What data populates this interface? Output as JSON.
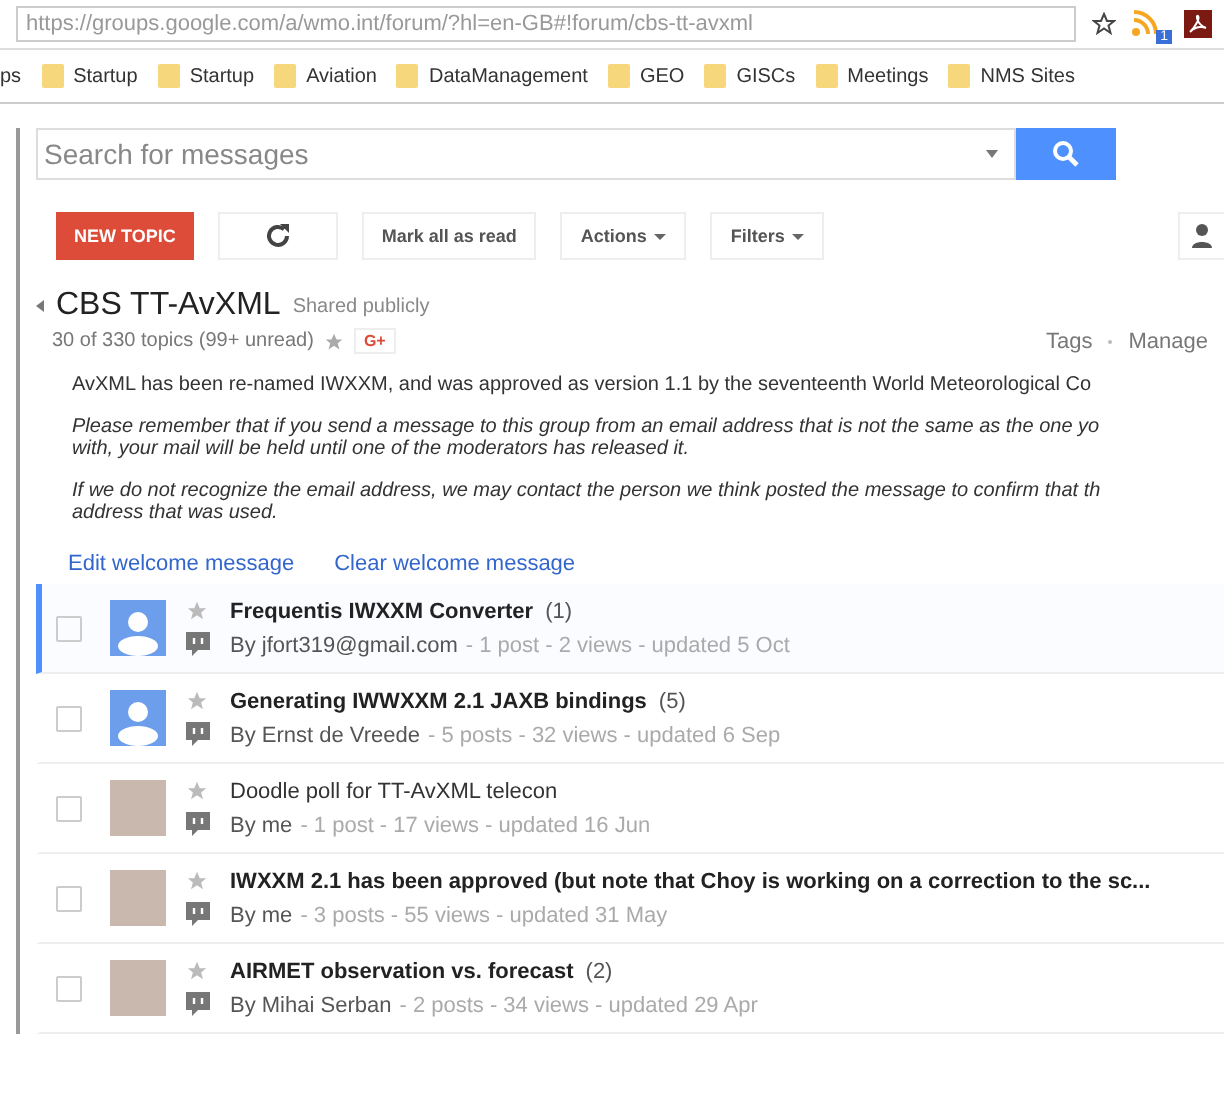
{
  "address_bar": {
    "url": "https://groups.google.com/a/wmo.int/forum/?hl=en-GB#!forum/cbs-tt-avxml",
    "extension_badge": "1"
  },
  "bookmarks": [
    "ps",
    "Startup",
    "Startup",
    "Aviation",
    "DataManagement",
    "GEO",
    "GISCs",
    "Meetings",
    "NMS Sites"
  ],
  "search": {
    "placeholder": "Search for messages"
  },
  "toolbar": {
    "new_topic": "NEW TOPIC",
    "mark_all_read": "Mark all as read",
    "actions": "Actions",
    "filters": "Filters"
  },
  "group": {
    "name": "CBS TT-AvXML",
    "visibility": "Shared publicly",
    "count": "30 of 330 topics (99+ unread)",
    "gplus": "G+",
    "links": [
      "Tags",
      "Manage"
    ]
  },
  "welcome": [
    {
      "italic": false,
      "lines": [
        "AvXML has been re-named IWXXM, and was approved as version 1.1 by the seventeenth World Meteorological Co"
      ]
    },
    {
      "italic": true,
      "lines": [
        "Please remember that if you send a message to this group from an email address that is not the same as the one yo",
        "with, your mail will be held until one of the moderators has released it."
      ]
    },
    {
      "italic": true,
      "lines": [
        "If we do not recognize the email address, we may contact the person we think posted the message to confirm that th",
        "address that was used."
      ]
    }
  ],
  "welcome_actions": [
    "Edit welcome message",
    "Clear welcome message"
  ],
  "topics": [
    {
      "title": "Frequentis IWXXM Converter",
      "count": "(1)",
      "author": "By jfort319@gmail.com",
      "stats": "- 1 post - 2 views - updated 5 Oct",
      "unread": true,
      "selected": true,
      "kind": "default"
    },
    {
      "title": "Generating IWWXXM 2.1 JAXB bindings",
      "count": "(5)",
      "author": "By Ernst de Vreede",
      "stats": "- 5 posts - 32 views - updated 6 Sep",
      "unread": true,
      "selected": false,
      "kind": "default"
    },
    {
      "title": "Doodle poll for TT-AvXML telecon",
      "author": "By me",
      "stats": "- 1 post - 17 views - updated 16 Jun",
      "unread": false,
      "selected": false,
      "kind": "photo"
    },
    {
      "title": "IWXXM 2.1 has been approved (but note that Choy is working on a correction to the sc...",
      "author": "By me",
      "stats": "- 3 posts - 55 views - updated 31 May",
      "unread": true,
      "selected": false,
      "kind": "photo"
    },
    {
      "title": "AIRMET observation vs. forecast",
      "count": "(2)",
      "author": "By Mihai Serban",
      "stats": "- 2 posts - 34 views - updated 29 Apr",
      "unread": true,
      "selected": false,
      "kind": "photo"
    }
  ]
}
